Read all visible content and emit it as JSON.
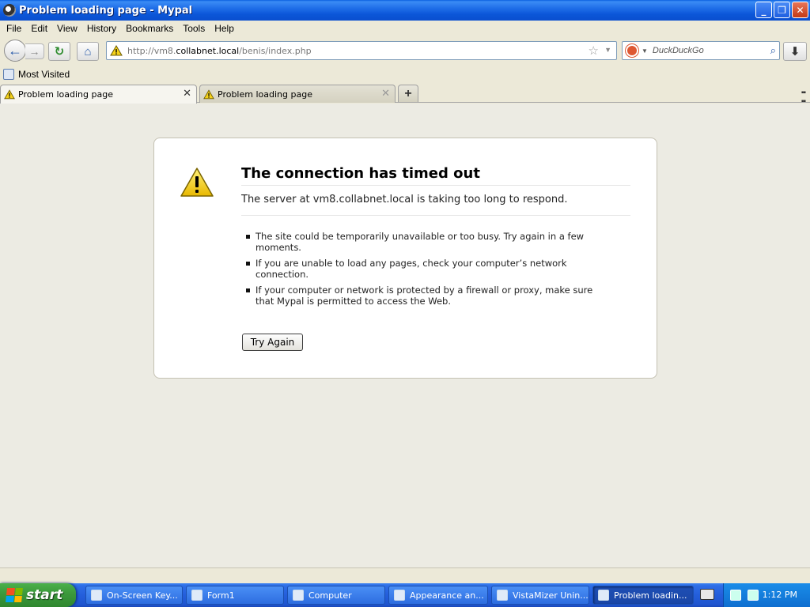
{
  "window": {
    "title": "Problem loading page - Mypal",
    "minimize_label": "_",
    "maximize_label": "❐",
    "close_label": "✕"
  },
  "menu": {
    "items": [
      "File",
      "Edit",
      "View",
      "History",
      "Bookmarks",
      "Tools",
      "Help"
    ]
  },
  "navbar": {
    "url_prefix": "http://vm8.",
    "url_host": "collabnet.local",
    "url_suffix": "/benis/index.php",
    "search_placeholder": "DuckDuckGo"
  },
  "bookmarks": {
    "most_visited": "Most Visited"
  },
  "tabs": [
    {
      "label": "Problem loading page",
      "active": true
    },
    {
      "label": "Problem loading page",
      "active": false
    }
  ],
  "error": {
    "title": "The connection has timed out",
    "description": "The server at vm8.collabnet.local is taking too long to respond.",
    "bullets": [
      "The site could be temporarily unavailable or too busy. Try again in a few moments.",
      "If you are unable to load any pages, check your computer’s network connection.",
      "If your computer or network is protected by a firewall or proxy, make sure that Mypal is permitted to access the Web."
    ],
    "button": "Try Again"
  },
  "taskbar": {
    "start_label": "start",
    "tasks": [
      "On-Screen Key...",
      "Form1",
      "Computer",
      "Appearance an...",
      "VistaMizer Unin...",
      "Problem loadin..."
    ],
    "clock": "1:12 PM"
  },
  "colors": {
    "titlebar": "#0a56d8",
    "taskbar": "#245edb",
    "start": "#3c9a3c",
    "warning": "#f5d21a"
  }
}
